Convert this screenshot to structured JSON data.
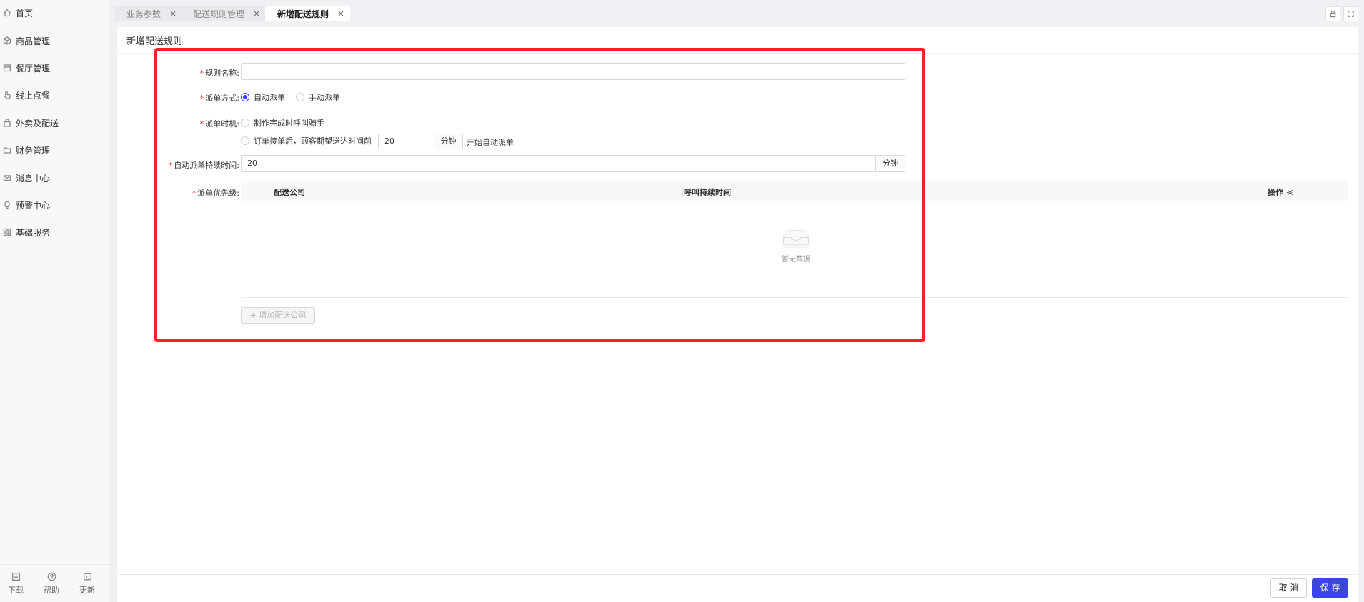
{
  "sidebar": {
    "items": [
      {
        "label": "首页",
        "icon": "home-icon"
      },
      {
        "label": "商品管理",
        "icon": "cube-icon"
      },
      {
        "label": "餐厅管理",
        "icon": "store-icon"
      },
      {
        "label": "线上点餐",
        "icon": "hand-icon"
      },
      {
        "label": "外卖及配送",
        "icon": "bag-icon"
      },
      {
        "label": "财务管理",
        "icon": "folder-icon"
      },
      {
        "label": "消息中心",
        "icon": "mail-icon"
      },
      {
        "label": "预警中心",
        "icon": "bulb-icon"
      },
      {
        "label": "基础服务",
        "icon": "grid-icon"
      }
    ],
    "tools": [
      {
        "label": "下载",
        "icon": "download-icon"
      },
      {
        "label": "帮助",
        "icon": "help-icon"
      },
      {
        "label": "更新",
        "icon": "update-icon"
      }
    ]
  },
  "tabs": [
    {
      "label": "业务参数"
    },
    {
      "label": "配送规则管理"
    },
    {
      "label": "新增配送规则"
    }
  ],
  "tab_close": "×",
  "page": {
    "title": "新增配送规则"
  },
  "form": {
    "required_mark": "*",
    "rule_name_label": "规则名称:",
    "rule_name_value": "",
    "dispatch_mode_label": "派单方式:",
    "dispatch_mode_options": [
      "自动派单",
      "手动派单"
    ],
    "dispatch_mode_selected": "自动派单",
    "dispatch_timing_label": "派单时机:",
    "timing_option_1": "制作完成时呼叫骑手",
    "timing_option_2_prefix": "订单接单后，顾客期望送达时间前",
    "timing_minutes_value": "20",
    "minute_unit": "分钟",
    "timing_option_2_suffix": "开始自动派单",
    "duration_label": "自动派单持续时间:",
    "duration_value": "20",
    "priority_label": "派单优先级:"
  },
  "table": {
    "columns": [
      "配送公司",
      "呼叫持续时间",
      "操作"
    ],
    "empty_text": "暂无数据",
    "add_button": "+ 增加配送公司"
  },
  "footer": {
    "cancel": "取 消",
    "save": "保 存"
  },
  "colors": {
    "primary": "#3b44e6",
    "required": "#e5403b",
    "highlight": "#ee2424"
  }
}
